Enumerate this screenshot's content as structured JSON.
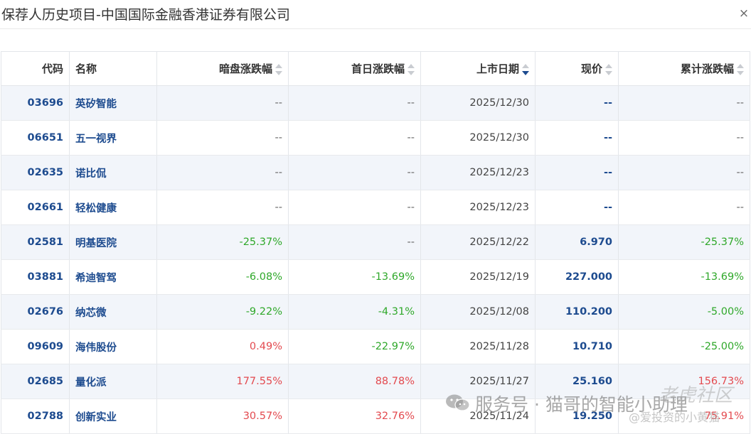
{
  "dialog": {
    "title": "保荐人历史项目-中国国际金融香港证券有限公司",
    "close_label": "×"
  },
  "table": {
    "headers": {
      "code": "代码",
      "name": "名称",
      "grey": "暗盘涨跌幅",
      "first_day": "首日涨跌幅",
      "listing_date": "上市日期",
      "price": "现价",
      "cumulative": "累计涨跌幅"
    },
    "sort_state": {
      "listing_date": "desc"
    },
    "rows": [
      {
        "code": "03696",
        "name": "英矽智能",
        "grey": "--",
        "first_day": "--",
        "listing_date": "2025/12/30",
        "price": "--",
        "cumulative": "--"
      },
      {
        "code": "06651",
        "name": "五一视界",
        "grey": "--",
        "first_day": "--",
        "listing_date": "2025/12/30",
        "price": "--",
        "cumulative": "--"
      },
      {
        "code": "02635",
        "name": "诺比侃",
        "grey": "--",
        "first_day": "--",
        "listing_date": "2025/12/23",
        "price": "--",
        "cumulative": "--"
      },
      {
        "code": "02661",
        "name": "轻松健康",
        "grey": "--",
        "first_day": "--",
        "listing_date": "2025/12/23",
        "price": "--",
        "cumulative": "--"
      },
      {
        "code": "02581",
        "name": "明基医院",
        "grey": "-25.37%",
        "first_day": "--",
        "listing_date": "2025/12/22",
        "price": "6.970",
        "cumulative": "-25.37%"
      },
      {
        "code": "03881",
        "name": "希迪智驾",
        "grey": "-6.08%",
        "first_day": "-13.69%",
        "listing_date": "2025/12/19",
        "price": "227.000",
        "cumulative": "-13.69%"
      },
      {
        "code": "02676",
        "name": "纳芯微",
        "grey": "-9.22%",
        "first_day": "-4.31%",
        "listing_date": "2025/12/08",
        "price": "110.200",
        "cumulative": "-5.00%"
      },
      {
        "code": "09609",
        "name": "海伟股份",
        "grey": "0.49%",
        "first_day": "-22.97%",
        "listing_date": "2025/11/28",
        "price": "10.710",
        "cumulative": "-25.00%"
      },
      {
        "code": "02685",
        "name": "量化派",
        "grey": "177.55%",
        "first_day": "88.78%",
        "listing_date": "2025/11/27",
        "price": "25.160",
        "cumulative": "156.73%"
      },
      {
        "code": "02788",
        "name": "创新实业",
        "grey": "30.57%",
        "first_day": "32.76%",
        "listing_date": "2025/11/24",
        "price": "19.250",
        "cumulative": "75.91%"
      }
    ]
  },
  "colors": {
    "positive": "#e34a4f",
    "negative": "#2fa82a",
    "link": "#1d4b8f",
    "stripe": "#f2f5fa"
  },
  "watermark": {
    "icon": "wechat-icon",
    "main": "服务号 · 猫哥的智能小助理",
    "brand": "老虎社区",
    "sub": "@爱投资的小黄猫"
  }
}
